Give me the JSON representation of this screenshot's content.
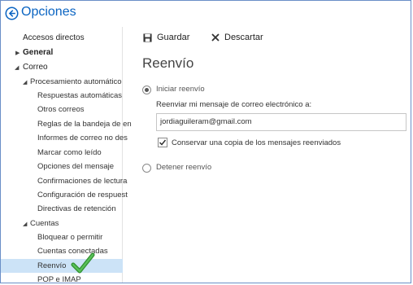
{
  "app": {
    "title": "Opciones"
  },
  "sidebar": {
    "items": [
      {
        "label": "Accesos directos"
      },
      {
        "label": "General"
      },
      {
        "label": "Correo"
      },
      {
        "label": "Procesamiento automático"
      },
      {
        "label": "Respuestas automáticas"
      },
      {
        "label": "Otros correos"
      },
      {
        "label": "Reglas de la bandeja de en"
      },
      {
        "label": "Informes de correo no des"
      },
      {
        "label": "Marcar como leído"
      },
      {
        "label": "Opciones del mensaje"
      },
      {
        "label": "Confirmaciones de lectura"
      },
      {
        "label": "Configuración de respuest"
      },
      {
        "label": "Directivas de retención"
      },
      {
        "label": "Cuentas"
      },
      {
        "label": "Bloquear o permitir"
      },
      {
        "label": "Cuentas conectadas"
      },
      {
        "label": "Reenvío",
        "selected": true
      },
      {
        "label": "POP e IMAP"
      }
    ]
  },
  "toolbar": {
    "save_label": "Guardar",
    "discard_label": "Descartar"
  },
  "main": {
    "title": "Reenvío",
    "start_option": "Iniciar reenvío",
    "forward_prompt": "Reenviar mi mensaje de correo electrónico a:",
    "email_value": "jordiaguileram@gmail.com",
    "keep_copy_label": "Conservar una copia de los mensajes reenviados",
    "stop_option": "Detener reenvío"
  },
  "colors": {
    "accent": "#0a64c2",
    "selection": "#cce3f7",
    "check_green": "#3aa23a"
  }
}
